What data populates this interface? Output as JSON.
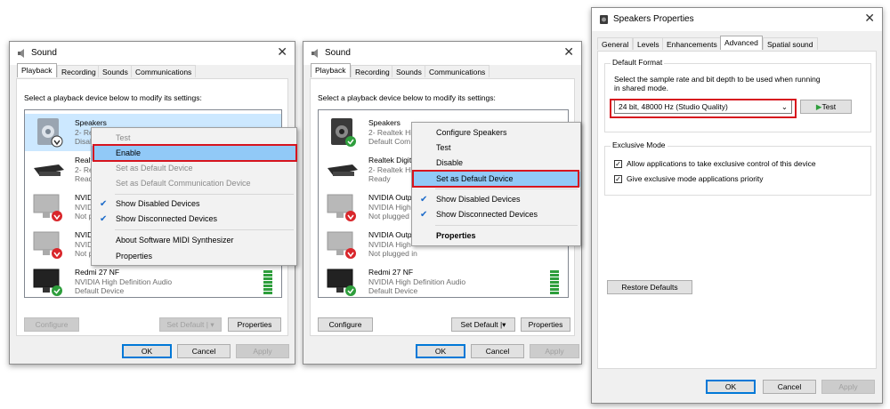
{
  "sound_left": {
    "title": "Sound",
    "tabs": [
      "Playback",
      "Recording",
      "Sounds",
      "Communications"
    ],
    "hint": "Select a playback device below to modify its settings:",
    "devices": [
      {
        "name": "Speakers",
        "l2": "2- Rea",
        "l3": "Disab"
      },
      {
        "name": "Realt",
        "l2": "2- Re",
        "l3": "Ready"
      },
      {
        "name": "NVIDI",
        "l2": "NVIDI",
        "l3": "Not p"
      },
      {
        "name": "NVIDI",
        "l2": "NVIDI",
        "l3": "Not p"
      },
      {
        "name": "Redmi 27 NF",
        "l2": "NVIDIA High Definition Audio",
        "l3": "Default Device"
      }
    ],
    "menu": [
      "Test",
      "Enable",
      "Set as Default Device",
      "Set as Default Communication Device",
      "Show Disabled Devices",
      "Show Disconnected Devices",
      "About Software MIDI Synthesizer",
      "Properties"
    ],
    "buttons": {
      "configure": "Configure",
      "set_default": "Set Default",
      "properties": "Properties",
      "ok": "OK",
      "cancel": "Cancel",
      "apply": "Apply"
    }
  },
  "sound_mid": {
    "title": "Sound",
    "tabs": [
      "Playback",
      "Recording",
      "Sounds",
      "Communications"
    ],
    "hint": "Select a playback device below to modify its settings:",
    "devices": [
      {
        "name": "Speakers",
        "l2": "2- Realtek Hi",
        "l3": "Default Com"
      },
      {
        "name": "Realtek Digit",
        "l2": "2- Realtek Hi",
        "l3": "Ready"
      },
      {
        "name": "NVIDIA Outp",
        "l2": "NVIDIA High",
        "l3": "Not plugged"
      },
      {
        "name": "NVIDIA Outp",
        "l2": "NVIDIA High",
        "l3": "Not plugged in"
      },
      {
        "name": "Redmi 27 NF",
        "l2": "NVIDIA High Definition Audio",
        "l3": "Default Device"
      }
    ],
    "menu": [
      "Configure Speakers",
      "Test",
      "Disable",
      "Set as Default Device",
      "Show Disabled Devices",
      "Show Disconnected Devices",
      "Properties"
    ],
    "buttons": {
      "configure": "Configure",
      "set_default": "Set Default",
      "properties": "Properties",
      "ok": "OK",
      "cancel": "Cancel",
      "apply": "Apply"
    }
  },
  "speakers_props": {
    "title": "Speakers Properties",
    "tabs": [
      "General",
      "Levels",
      "Enhancements",
      "Advanced",
      "Spatial sound"
    ],
    "default_format": {
      "label": "Default Format",
      "desc1": "Select the sample rate and bit depth to be used when running",
      "desc2": "in shared mode.",
      "value": "24 bit, 48000 Hz (Studio Quality)",
      "test": "Test"
    },
    "exclusive": {
      "label": "Exclusive Mode",
      "opt1": "Allow applications to take exclusive control of this device",
      "opt2": "Give exclusive mode applications priority"
    },
    "restore": "Restore Defaults",
    "buttons": {
      "ok": "OK",
      "cancel": "Cancel",
      "apply": "Apply"
    }
  },
  "colors": {
    "highlight": "#cce8ff",
    "menu_highlight": "#91c9f7",
    "annotation": "#d7141e",
    "accent": "#0078d7"
  }
}
